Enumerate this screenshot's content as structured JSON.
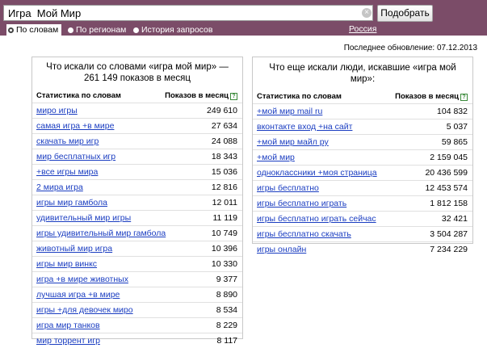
{
  "search": {
    "value": "Игра  Мой Мир",
    "clear_glyph": "×",
    "submit_label": "Подобрать"
  },
  "modes": [
    {
      "label": "По словам",
      "active": true
    },
    {
      "label": "По регионам",
      "active": false
    },
    {
      "label": "История запросов",
      "active": false
    }
  ],
  "region_label": "Россия",
  "updated": "Последнее обновление: 07.12.2013",
  "left_panel": {
    "title": "Что искали со словами «игра мой мир» — 261 149 показов в месяц",
    "col1": "Статистика по словам",
    "col2": "Показов в месяц",
    "help_glyph": "?",
    "rows": [
      {
        "keyword": "миро игры",
        "count": "249 610"
      },
      {
        "keyword": "самая игра +в мире",
        "count": "27 634"
      },
      {
        "keyword": "скачать мир игр",
        "count": "24 088"
      },
      {
        "keyword": "мир бесплатных игр",
        "count": "18 343"
      },
      {
        "keyword": "+все игры мира",
        "count": "15 036"
      },
      {
        "keyword": "2 мира игра",
        "count": "12 816"
      },
      {
        "keyword": "игры мир гамбола",
        "count": "12 011"
      },
      {
        "keyword": "удивительный мир игры",
        "count": "11 119"
      },
      {
        "keyword": "игры удивительный мир гамбола",
        "count": "10 749"
      },
      {
        "keyword": "животный мир игра",
        "count": "10 396"
      },
      {
        "keyword": "игры мир винкс",
        "count": "10 330"
      },
      {
        "keyword": "игра +в мире животных",
        "count": "9 377"
      },
      {
        "keyword": "лучшая игра +в мире",
        "count": "8 890"
      },
      {
        "keyword": "игры +для девочек миро",
        "count": "8 534"
      },
      {
        "keyword": "игра мир танков",
        "count": "8 229"
      },
      {
        "keyword": "мир торрент игр",
        "count": "8 117"
      }
    ]
  },
  "right_panel": {
    "title": "Что еще искали люди, искавшие «игра мой мир»:",
    "col1": "Статистика по словам",
    "col2": "Показов в месяц",
    "help_glyph": "?",
    "rows": [
      {
        "keyword": "+мой мир mail ru",
        "count": "104 832"
      },
      {
        "keyword": "вконтакте вход +на сайт",
        "count": "5 037"
      },
      {
        "keyword": "+мой мир майл ру",
        "count": "59 865"
      },
      {
        "keyword": "+мой мир",
        "count": "2 159 045"
      },
      {
        "keyword": "одноклассники +моя страница",
        "count": "20 436 599"
      },
      {
        "keyword": "игры бесплатно",
        "count": "12 453 574"
      },
      {
        "keyword": "игры бесплатно играть",
        "count": "1 812 158"
      },
      {
        "keyword": "игры бесплатно играть сейчас",
        "count": "32 421"
      },
      {
        "keyword": "игры бесплатно скачать",
        "count": "3 504 287"
      },
      {
        "keyword": "игры онлайн",
        "count": "7 234 229"
      }
    ]
  }
}
